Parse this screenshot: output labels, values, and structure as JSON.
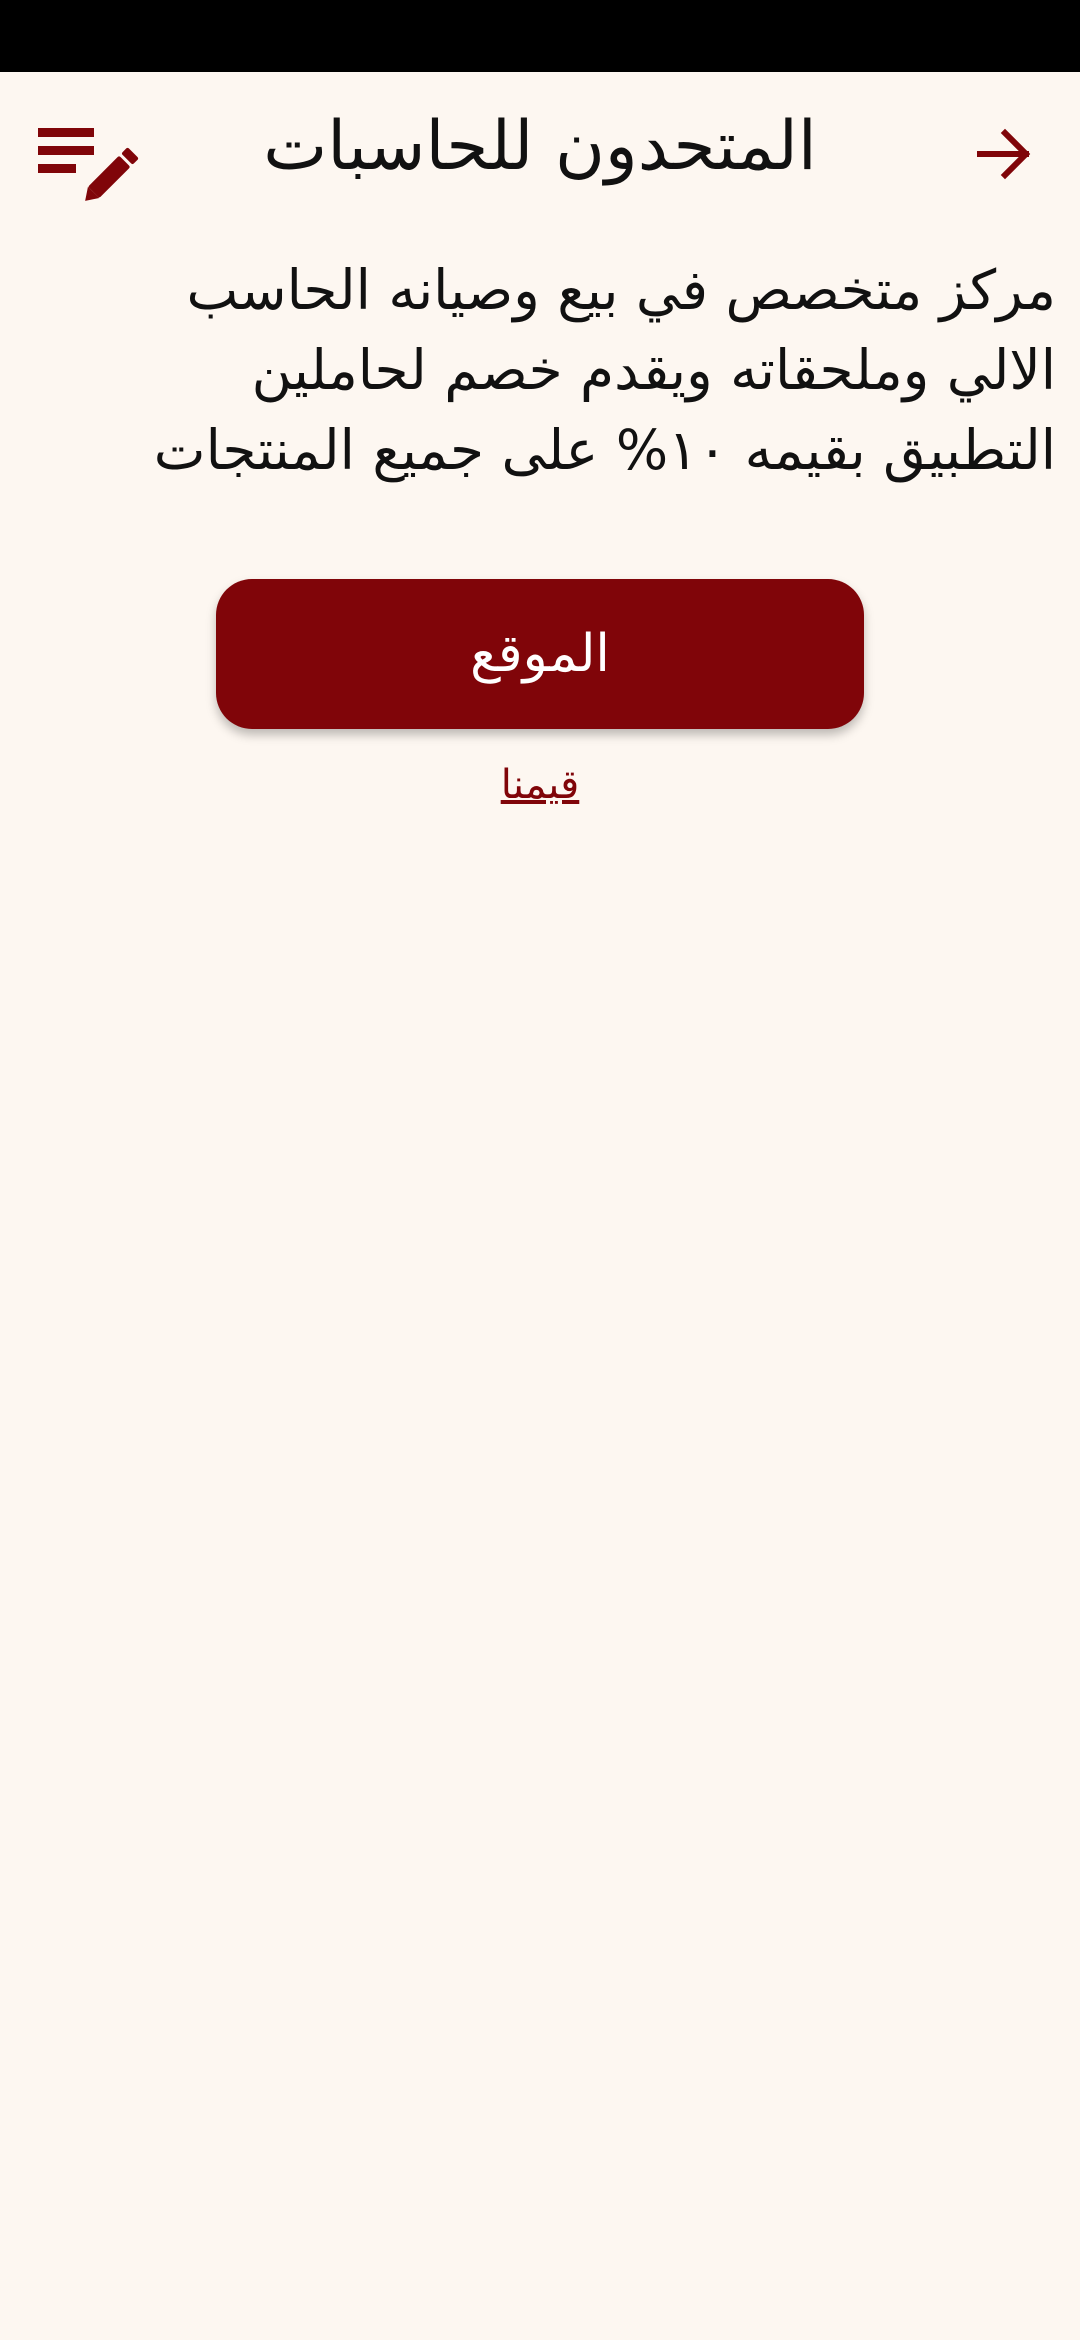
{
  "app_bar": {
    "title": "المتحدون للحاسبات",
    "back_icon": "arrow-right-icon",
    "menu_icon": "edit-list-icon"
  },
  "content": {
    "description": "مركز متخصص في بيع وصيانه الحاسب الالي وملحقاته ويقدم خصم لحاملين التطبيق بقيمه ١٠% على جميع المنتجات",
    "website_button_label": "الموقع",
    "rate_link_label": "قيمنا"
  },
  "colors": {
    "accent": "#800509",
    "background": "#fdf7f1",
    "status_bar": "#000000"
  }
}
